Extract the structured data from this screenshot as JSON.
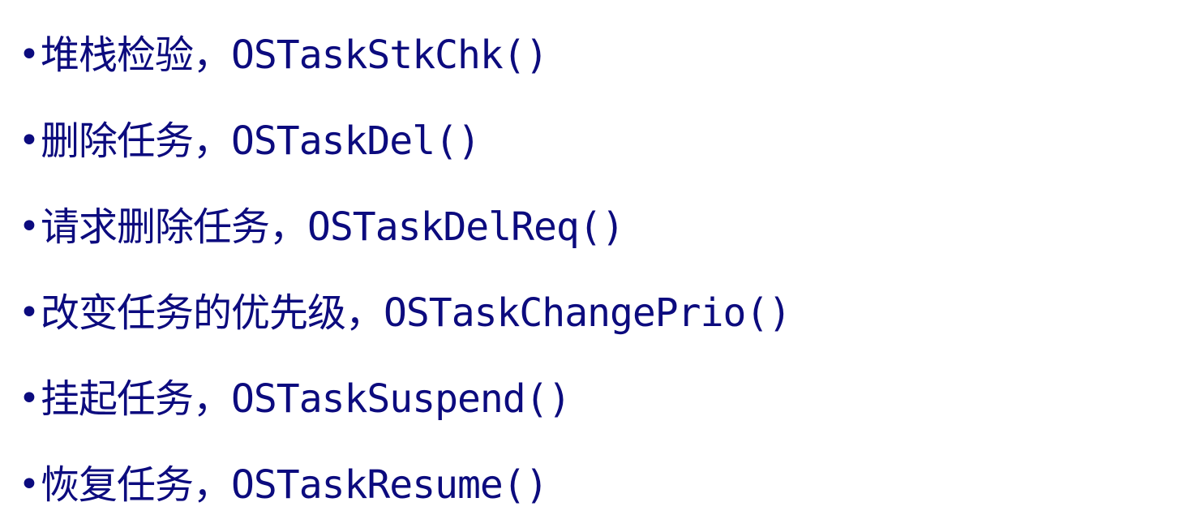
{
  "bullet_symbol": "•",
  "text_color": "#0c0b7e",
  "items": [
    {
      "text": "堆栈检验，OSTaskStkChk()"
    },
    {
      "text": "删除任务，OSTaskDel()"
    },
    {
      "text": "请求删除任务，OSTaskDelReq()"
    },
    {
      "text": "改变任务的优先级，OSTaskChangePrio()"
    },
    {
      "text": "挂起任务，OSTaskSuspend()"
    },
    {
      "text": "恢复任务，OSTaskResume()"
    }
  ]
}
